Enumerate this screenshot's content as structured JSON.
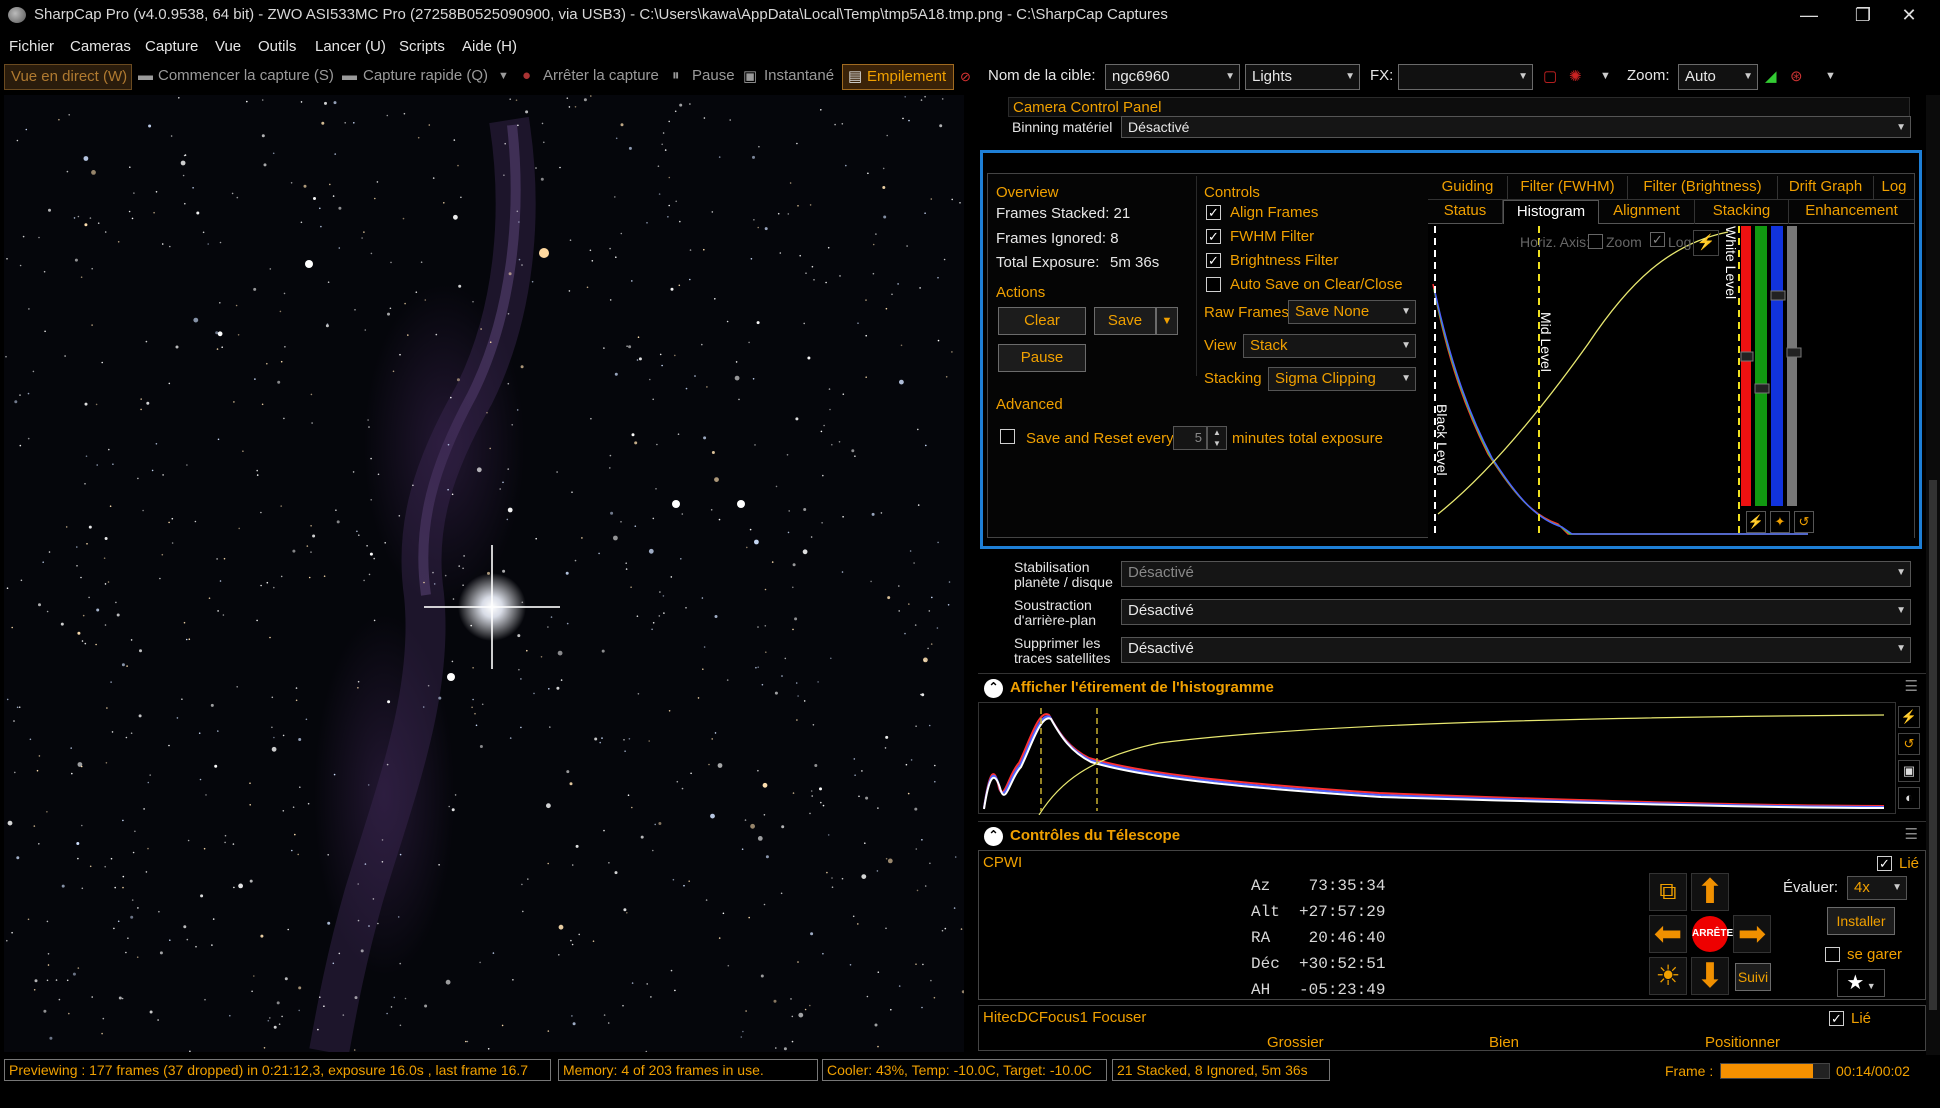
{
  "titlebar": {
    "title": "SharpCap Pro (v4.0.9538, 64 bit) - ZWO ASI533MC Pro (27258B0525090900, via USB3) - C:\\Users\\kawa\\AppData\\Local\\Temp\\tmp5A18.tmp.png - C:\\SharpCap Captures",
    "minimize": "—",
    "restore": "❐",
    "close": "✕"
  },
  "menu": [
    "Fichier",
    "Cameras",
    "Capture",
    "Vue",
    "Outils",
    "Lancer (U)",
    "Scripts",
    "Aide (H)"
  ],
  "toolbar": {
    "live_view": "Vue en direct (W)",
    "start_capture": "Commencer la capture (S)",
    "quick_capture": "Capture rapide (Q)",
    "stop_capture": "Arrêter la capture",
    "pause": "Pause",
    "snapshot": "Instantané",
    "stacking": "Empilement",
    "target_label": "Nom de la cible:",
    "target_value": "ngc6960",
    "frame_type": "Lights",
    "fx_label": "FX:",
    "fx_value": "",
    "zoom_label": "Zoom:",
    "zoom_value": "Auto"
  },
  "camera_panel": {
    "title": "Camera Control Panel",
    "binning_label": "Binning matériel",
    "binning_value": "Désactivé"
  },
  "stack": {
    "overview_title": "Overview",
    "frames_stacked": "Frames Stacked: 21",
    "frames_ignored": "Frames Ignored: 8",
    "total_exposure_label": "Total Exposure:",
    "total_exposure_value": "5m 36s",
    "actions_title": "Actions",
    "clear": "Clear",
    "save": "Save",
    "pause": "Pause",
    "advanced_title": "Advanced",
    "save_reset_label": "Save and Reset every",
    "save_reset_value": "5",
    "save_reset_unit": "minutes total exposure",
    "controls_title": "Controls",
    "align_frames": "Align Frames",
    "fwhm_filter": "FWHM Filter",
    "brightness_filter": "Brightness Filter",
    "auto_save": "Auto Save on Clear/Close",
    "raw_frames_label": "Raw Frames",
    "raw_frames_value": "Save None",
    "view_label": "View",
    "view_value": "Stack",
    "stacking_label": "Stacking",
    "stacking_value": "Sigma Clipping",
    "tabs_row1": [
      "Guiding",
      "Filter (FWHM)",
      "Filter (Brightness)",
      "Drift Graph",
      "Log"
    ],
    "tabs_row2": [
      "Status",
      "Histogram",
      "Alignment",
      "Stacking",
      "Enhancement"
    ],
    "horiz_axis": "Horiz. Axis:",
    "zoom_chk": "Zoom",
    "log_chk": "Log",
    "black_level": "Black Level",
    "mid_level": "Mid Level",
    "white_level": "White Level"
  },
  "options": {
    "stab_label": "Stabilisation planète / disque",
    "stab_value": "Désactivé",
    "bg_label": "Soustraction d'arrière-plan",
    "bg_value": "Désactivé",
    "sat_label": "Supprimer les traces satellites",
    "sat_value": "Désactivé"
  },
  "histogram_stretch": {
    "title": "Afficher l'étirement de l'histogramme"
  },
  "telescope": {
    "title": "Contrôles du Télescope",
    "mount": "CPWI",
    "linked": "Lié",
    "az": "Az    73:35:34",
    "alt": "Alt  +27:57:29",
    "ra": "RA    20:46:40",
    "dec": "Déc  +30:52:51",
    "ah": "AH   -05:23:49",
    "rate_label": "Évaluer:",
    "rate_value": "4x",
    "install": "Installer",
    "park": "se garer",
    "stop": "ARRÊTE",
    "track": "Suivi"
  },
  "focuser": {
    "name": "HitecDCFocus1 Focuser",
    "linked": "Lié",
    "coarse": "Grossier",
    "fine": "Bien",
    "position": "Positionner"
  },
  "status": {
    "preview": "Previewing : 177 frames (37 dropped) in 0:21:12,3, exposure 16.0s , last frame 16.7",
    "memory": "Memory: 4 of 203 frames in use.",
    "cooler": "Cooler: 43%, Temp: -10.0C, Target: -10.0C",
    "stacked": "21 Stacked, 8 Ignored, 5m 36s",
    "frame_label": "Frame :",
    "frame_time": "00:14/00:02",
    "frame_progress": 0.85
  }
}
